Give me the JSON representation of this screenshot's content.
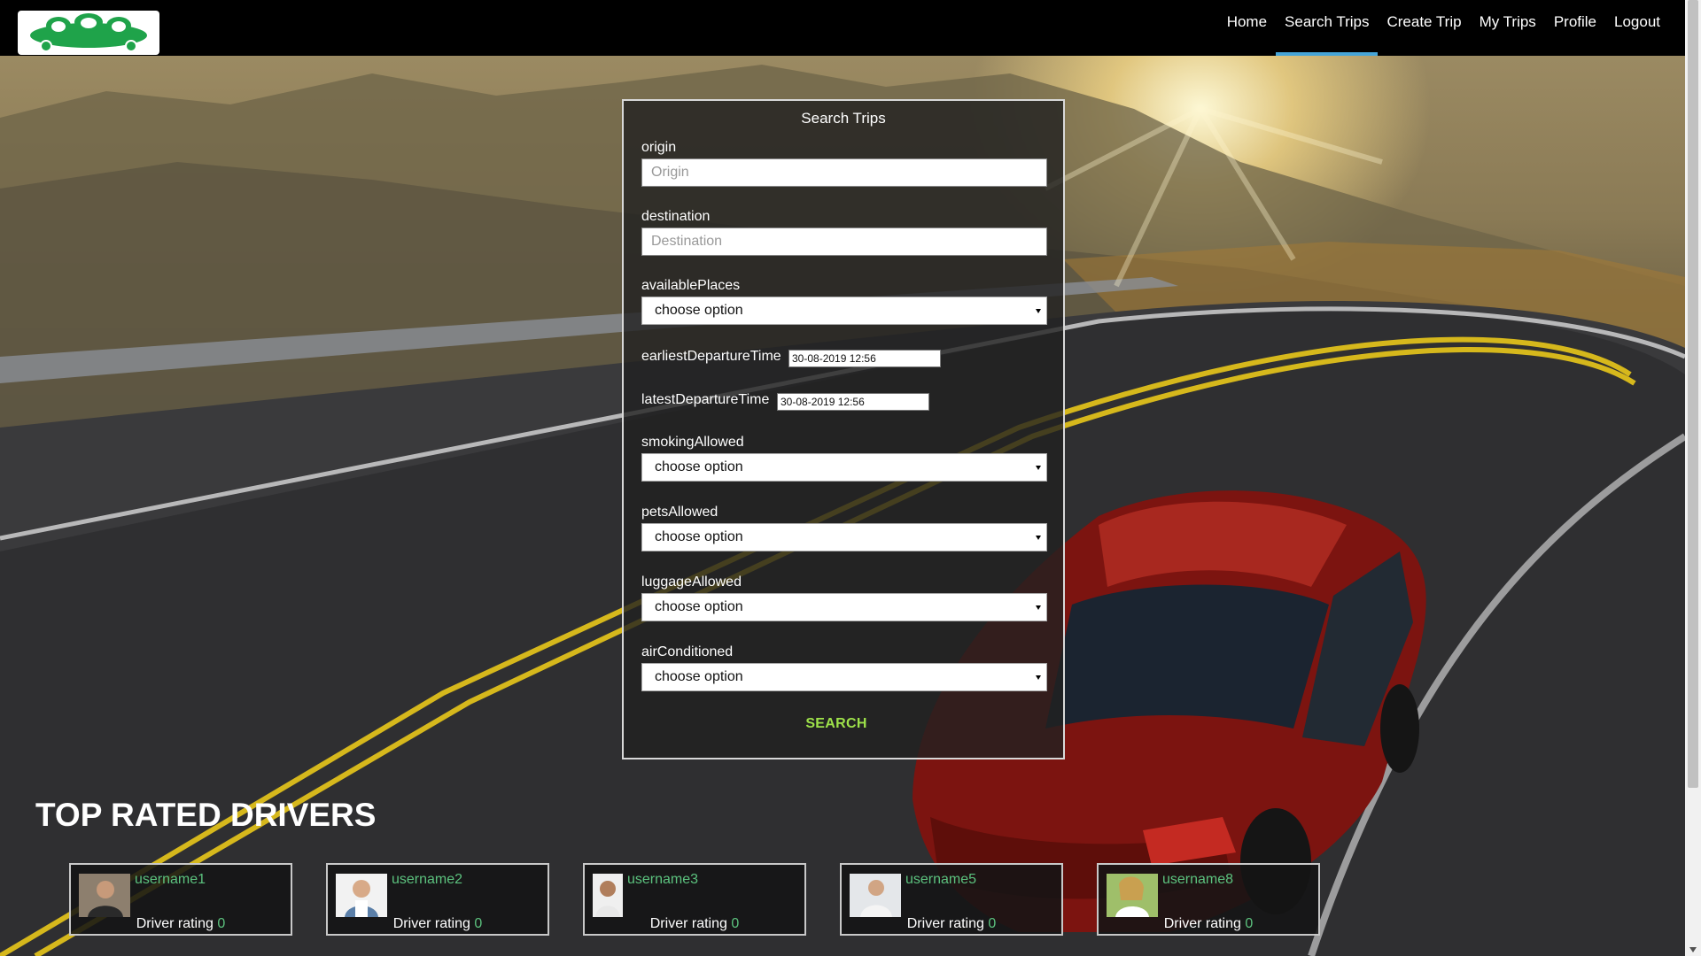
{
  "brand": {
    "logo_icon": "car-group-icon",
    "logo_color": "#1fa34a"
  },
  "nav": {
    "items": [
      {
        "label": "Home",
        "active": false
      },
      {
        "label": "Search Trips",
        "active": true
      },
      {
        "label": "Create Trip",
        "active": false
      },
      {
        "label": "My Trips",
        "active": false
      },
      {
        "label": "Profile",
        "active": false
      },
      {
        "label": "Logout",
        "active": false
      }
    ],
    "active_color": "#46a5d8"
  },
  "search": {
    "title": "Search Trips",
    "origin": {
      "label": "origin",
      "placeholder": "Origin",
      "value": ""
    },
    "destination": {
      "label": "destination",
      "placeholder": "Destination",
      "value": ""
    },
    "available_places": {
      "label": "availablePlaces",
      "value": "choose option"
    },
    "earliest_departure": {
      "label": "earliestDepartureTime",
      "value": "30-08-2019 12:56"
    },
    "latest_departure": {
      "label": "latestDepartureTime",
      "value": "30-08-2019 12:56"
    },
    "smoking": {
      "label": "smokingAllowed",
      "value": "choose option"
    },
    "pets": {
      "label": "petsAllowed",
      "value": "choose option"
    },
    "luggage": {
      "label": "luggageAllowed",
      "value": "choose option"
    },
    "air_conditioned": {
      "label": "airConditioned",
      "value": "choose option"
    },
    "submit_label": "SEARCH",
    "submit_color": "#9ee24a"
  },
  "top_drivers": {
    "title": "TOP RATED DRIVERS",
    "rating_label": "Driver rating",
    "name_color": "#5cc27e",
    "drivers": [
      {
        "username": "username1",
        "rating": "0"
      },
      {
        "username": "username2",
        "rating": "0"
      },
      {
        "username": "username3",
        "rating": "0"
      },
      {
        "username": "username5",
        "rating": "0"
      },
      {
        "username": "username8",
        "rating": "0"
      }
    ]
  }
}
